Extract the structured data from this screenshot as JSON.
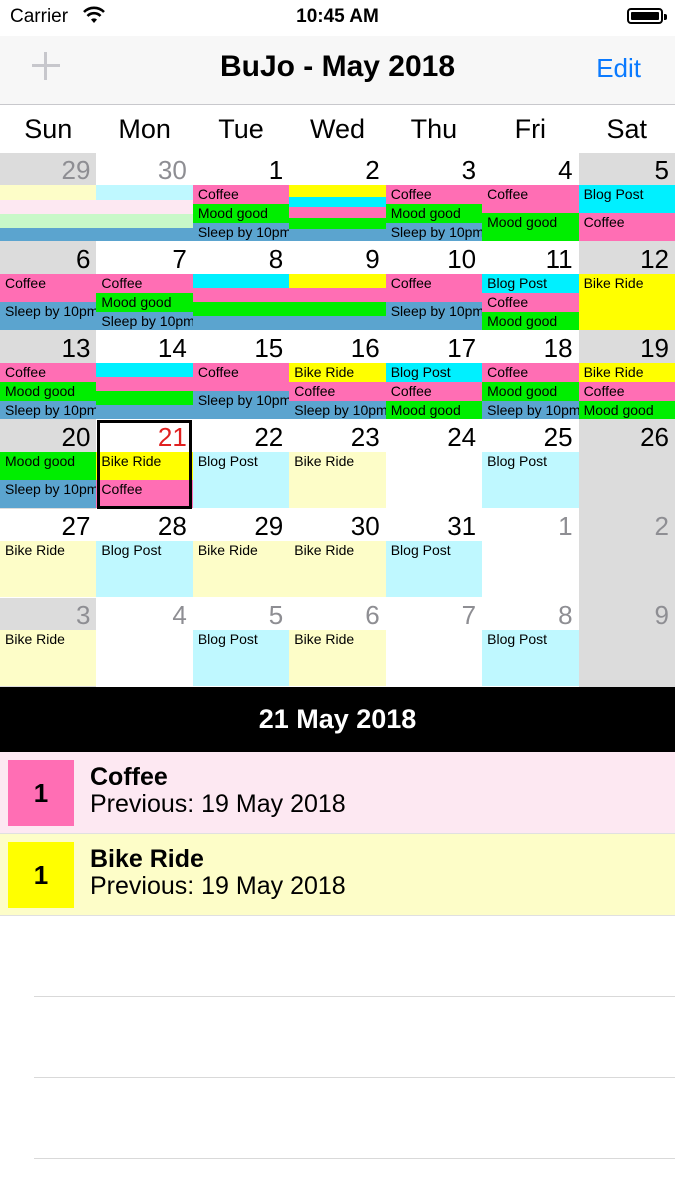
{
  "status": {
    "carrier": "Carrier",
    "time": "10:45 AM"
  },
  "nav": {
    "title": "BuJo - May 2018",
    "edit": "Edit"
  },
  "weekdays": [
    "Sun",
    "Mon",
    "Tue",
    "Wed",
    "Thu",
    "Fri",
    "Sat"
  ],
  "colors": {
    "coffee": "#ff6eb4",
    "mood": "#00ee00",
    "sleep": "#5ba4cf",
    "blog": "#00f0ff",
    "bike": "#ffff00",
    "coffee_light": "#fde8f2",
    "blog_light": "#bff8ff",
    "bike_light": "#fdfdc8",
    "mood_light": "#c8f8c8",
    "gray_cell": "#dcdcdc",
    "today": "#e02020",
    "accent": "#0a7aff"
  },
  "calendar": {
    "weeks": [
      {
        "days": [
          {
            "day": "29",
            "dim": true,
            "gray": true,
            "events": [
              {
                "label": "",
                "type": "bike",
                "light": true,
                "h": 15
              },
              {
                "label": "",
                "type": "coffee",
                "light": true,
                "h": 14
              },
              {
                "label": "",
                "type": "mood",
                "light": true,
                "h": 14
              },
              {
                "label": "",
                "type": "sleep",
                "h": 13
              }
            ]
          },
          {
            "day": "30",
            "dim": true,
            "gray": false,
            "events": [
              {
                "label": "",
                "type": "blog",
                "light": true,
                "h": 15
              },
              {
                "label": "",
                "type": "coffee",
                "light": true,
                "h": 14
              },
              {
                "label": "",
                "type": "mood",
                "light": true,
                "h": 14
              },
              {
                "label": "",
                "type": "sleep",
                "h": 13
              }
            ]
          },
          {
            "day": "1",
            "events": [
              {
                "label": "Coffee",
                "type": "coffee",
                "h": 19
              },
              {
                "label": "Mood good",
                "type": "mood",
                "h": 19
              },
              {
                "label": "Sleep by 10pm",
                "type": "sleep",
                "h": 18
              }
            ]
          },
          {
            "day": "2",
            "events": [
              {
                "label": "",
                "type": "bike",
                "h": 12
              },
              {
                "label": "",
                "type": "blog",
                "h": 10
              },
              {
                "label": "",
                "type": "coffee",
                "h": 11
              },
              {
                "label": "",
                "type": "mood",
                "h": 11
              },
              {
                "label": "",
                "type": "sleep",
                "h": 12
              }
            ]
          },
          {
            "day": "3",
            "events": [
              {
                "label": "Coffee",
                "type": "coffee",
                "h": 19
              },
              {
                "label": "Mood good",
                "type": "mood",
                "h": 19
              },
              {
                "label": "Sleep by 10pm",
                "type": "sleep",
                "h": 18
              }
            ]
          },
          {
            "day": "4",
            "events": [
              {
                "label": "Coffee",
                "type": "coffee",
                "h": 28
              },
              {
                "label": "Mood good",
                "type": "mood",
                "h": 28
              }
            ]
          },
          {
            "day": "5",
            "gray": true,
            "events": [
              {
                "label": "Blog Post",
                "type": "blog",
                "h": 28
              },
              {
                "label": "Coffee",
                "type": "coffee",
                "h": 28
              }
            ]
          }
        ]
      },
      {
        "days": [
          {
            "day": "6",
            "gray": true,
            "events": [
              {
                "label": "Coffee",
                "type": "coffee",
                "h": 28
              },
              {
                "label": "Sleep by 10pm",
                "type": "sleep",
                "h": 28
              }
            ]
          },
          {
            "day": "7",
            "events": [
              {
                "label": "Coffee",
                "type": "coffee",
                "h": 19
              },
              {
                "label": "Mood good",
                "type": "mood",
                "h": 19
              },
              {
                "label": "Sleep by 10pm",
                "type": "sleep",
                "h": 18
              }
            ]
          },
          {
            "day": "8",
            "events": [
              {
                "label": "",
                "type": "blog",
                "h": 14
              },
              {
                "label": "",
                "type": "coffee",
                "h": 14
              },
              {
                "label": "",
                "type": "mood",
                "h": 14
              },
              {
                "label": "",
                "type": "sleep",
                "h": 14
              }
            ]
          },
          {
            "day": "9",
            "events": [
              {
                "label": "",
                "type": "bike",
                "h": 14
              },
              {
                "label": "",
                "type": "coffee",
                "h": 14
              },
              {
                "label": "",
                "type": "mood",
                "h": 14
              },
              {
                "label": "",
                "type": "sleep",
                "h": 14
              }
            ]
          },
          {
            "day": "10",
            "events": [
              {
                "label": "Coffee",
                "type": "coffee",
                "h": 28
              },
              {
                "label": "Sleep by 10pm",
                "type": "sleep",
                "h": 28
              }
            ]
          },
          {
            "day": "11",
            "events": [
              {
                "label": "Blog Post",
                "type": "blog",
                "h": 19
              },
              {
                "label": "Coffee",
                "type": "coffee",
                "h": 19
              },
              {
                "label": "Mood good",
                "type": "mood",
                "h": 18
              }
            ]
          },
          {
            "day": "12",
            "gray": true,
            "events": [
              {
                "label": "Bike Ride",
                "type": "bike",
                "h": 56
              }
            ]
          }
        ]
      },
      {
        "days": [
          {
            "day": "13",
            "gray": true,
            "events": [
              {
                "label": "Coffee",
                "type": "coffee",
                "h": 19
              },
              {
                "label": "Mood good",
                "type": "mood",
                "h": 19
              },
              {
                "label": "Sleep by 10pm",
                "type": "sleep",
                "h": 18
              }
            ]
          },
          {
            "day": "14",
            "events": [
              {
                "label": "",
                "type": "blog",
                "h": 14
              },
              {
                "label": "",
                "type": "coffee",
                "h": 14
              },
              {
                "label": "",
                "type": "mood",
                "h": 14
              },
              {
                "label": "",
                "type": "sleep",
                "h": 14
              }
            ]
          },
          {
            "day": "15",
            "events": [
              {
                "label": "Coffee",
                "type": "coffee",
                "h": 28
              },
              {
                "label": "Sleep by 10pm",
                "type": "sleep",
                "h": 28
              }
            ]
          },
          {
            "day": "16",
            "events": [
              {
                "label": "Bike Ride",
                "type": "bike",
                "h": 19
              },
              {
                "label": "Coffee",
                "type": "coffee",
                "h": 19
              },
              {
                "label": "Sleep by 10pm",
                "type": "sleep",
                "h": 18
              }
            ]
          },
          {
            "day": "17",
            "events": [
              {
                "label": "Blog Post",
                "type": "blog",
                "h": 19
              },
              {
                "label": "Coffee",
                "type": "coffee",
                "h": 19
              },
              {
                "label": "Mood good",
                "type": "mood",
                "h": 18
              }
            ]
          },
          {
            "day": "18",
            "events": [
              {
                "label": "Coffee",
                "type": "coffee",
                "h": 19
              },
              {
                "label": "Mood good",
                "type": "mood",
                "h": 19
              },
              {
                "label": "Sleep by 10pm",
                "type": "sleep",
                "h": 18
              }
            ]
          },
          {
            "day": "19",
            "gray": true,
            "events": [
              {
                "label": "Bike Ride",
                "type": "bike",
                "h": 19
              },
              {
                "label": "Coffee",
                "type": "coffee",
                "h": 19
              },
              {
                "label": "Mood good",
                "type": "mood",
                "h": 18
              }
            ]
          }
        ]
      },
      {
        "days": [
          {
            "day": "20",
            "gray": true,
            "events": [
              {
                "label": "Mood good",
                "type": "mood",
                "h": 28
              },
              {
                "label": "Sleep by 10pm",
                "type": "sleep",
                "h": 28
              }
            ]
          },
          {
            "day": "21",
            "today": true,
            "selected": true,
            "events": [
              {
                "label": "Bike Ride",
                "type": "bike",
                "h": 28
              },
              {
                "label": "Coffee",
                "type": "coffee",
                "h": 28
              }
            ]
          },
          {
            "day": "22",
            "events": [
              {
                "label": "Blog Post",
                "type": "blog",
                "light": true,
                "h": 56
              }
            ]
          },
          {
            "day": "23",
            "events": [
              {
                "label": "Bike Ride",
                "type": "bike",
                "light": true,
                "h": 56
              }
            ]
          },
          {
            "day": "24",
            "events": []
          },
          {
            "day": "25",
            "events": [
              {
                "label": "Blog Post",
                "type": "blog",
                "light": true,
                "h": 56
              }
            ]
          },
          {
            "day": "26",
            "gray": true,
            "events": []
          }
        ]
      },
      {
        "days": [
          {
            "day": "27",
            "events": [
              {
                "label": "Bike Ride",
                "type": "bike",
                "light": true,
                "h": 56
              }
            ]
          },
          {
            "day": "28",
            "events": [
              {
                "label": "Blog Post",
                "type": "blog",
                "light": true,
                "h": 56
              }
            ]
          },
          {
            "day": "29",
            "events": [
              {
                "label": "Bike Ride",
                "type": "bike",
                "light": true,
                "h": 56
              }
            ]
          },
          {
            "day": "30",
            "events": [
              {
                "label": "Bike Ride",
                "type": "bike",
                "light": true,
                "h": 56
              }
            ]
          },
          {
            "day": "31",
            "events": [
              {
                "label": "Blog Post",
                "type": "blog",
                "light": true,
                "h": 56
              }
            ]
          },
          {
            "day": "1",
            "dim": true,
            "events": []
          },
          {
            "day": "2",
            "dim": true,
            "gray": true,
            "events": []
          }
        ]
      },
      {
        "days": [
          {
            "day": "3",
            "dim": true,
            "gray": true,
            "events": [
              {
                "label": "Bike Ride",
                "type": "bike",
                "light": true,
                "h": 56
              }
            ]
          },
          {
            "day": "4",
            "dim": true,
            "events": []
          },
          {
            "day": "5",
            "dim": true,
            "events": [
              {
                "label": "Blog Post",
                "type": "blog",
                "light": true,
                "h": 56
              }
            ]
          },
          {
            "day": "6",
            "dim": true,
            "events": [
              {
                "label": "Bike Ride",
                "type": "bike",
                "light": true,
                "h": 56
              }
            ]
          },
          {
            "day": "7",
            "dim": true,
            "events": []
          },
          {
            "day": "8",
            "dim": true,
            "events": [
              {
                "label": "Blog Post",
                "type": "blog",
                "light": true,
                "h": 56
              }
            ]
          },
          {
            "day": "9",
            "dim": true,
            "gray": true,
            "events": []
          }
        ]
      }
    ]
  },
  "selected": {
    "title": "21 May 2018",
    "events": [
      {
        "count": "1",
        "name": "Coffee",
        "previous": "Previous: 19 May 2018",
        "type": "coffee"
      },
      {
        "count": "1",
        "name": "Bike Ride",
        "previous": "Previous: 19 May 2018",
        "type": "bike"
      }
    ]
  }
}
